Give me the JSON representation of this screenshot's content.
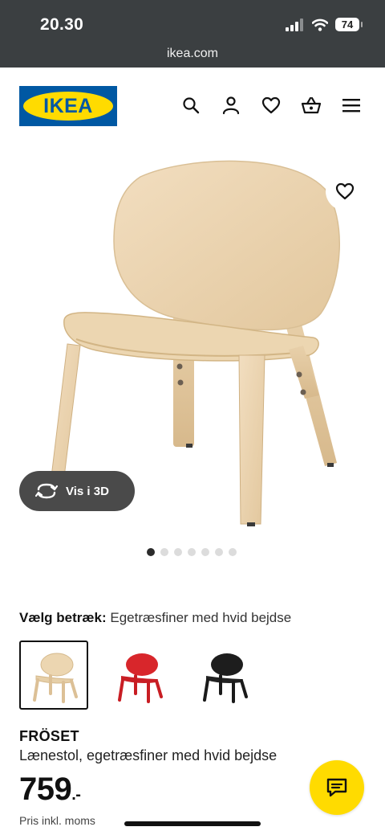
{
  "status_bar": {
    "time": "20.30",
    "battery": "74",
    "url": "ikea.com"
  },
  "header": {
    "logo_text": "IKEA"
  },
  "gallery": {
    "view_3d_label": "Vis i 3D",
    "image_count": 7,
    "active_image": 1
  },
  "options": {
    "label": "Vælg betræk:",
    "value": "Egetræsfiner med hvid bejdse",
    "swatches": [
      {
        "name": "Egetræsfiner med hvid bejdse",
        "color": "#e6cfa8",
        "selected": true
      },
      {
        "name": "red",
        "color": "#d8262b",
        "selected": false
      },
      {
        "name": "black",
        "color": "#1d1d1d",
        "selected": false
      }
    ]
  },
  "product": {
    "name": "FRÖSET",
    "description": "Lænestol, egetræsfiner med hvid bejdse",
    "price": "759",
    "price_suffix": ".-",
    "vat_note": "Pris inkl. moms"
  },
  "colors": {
    "ikea_blue": "#0058a3",
    "ikea_yellow": "#ffdb00",
    "chip_dark": "#4a4a4a"
  }
}
